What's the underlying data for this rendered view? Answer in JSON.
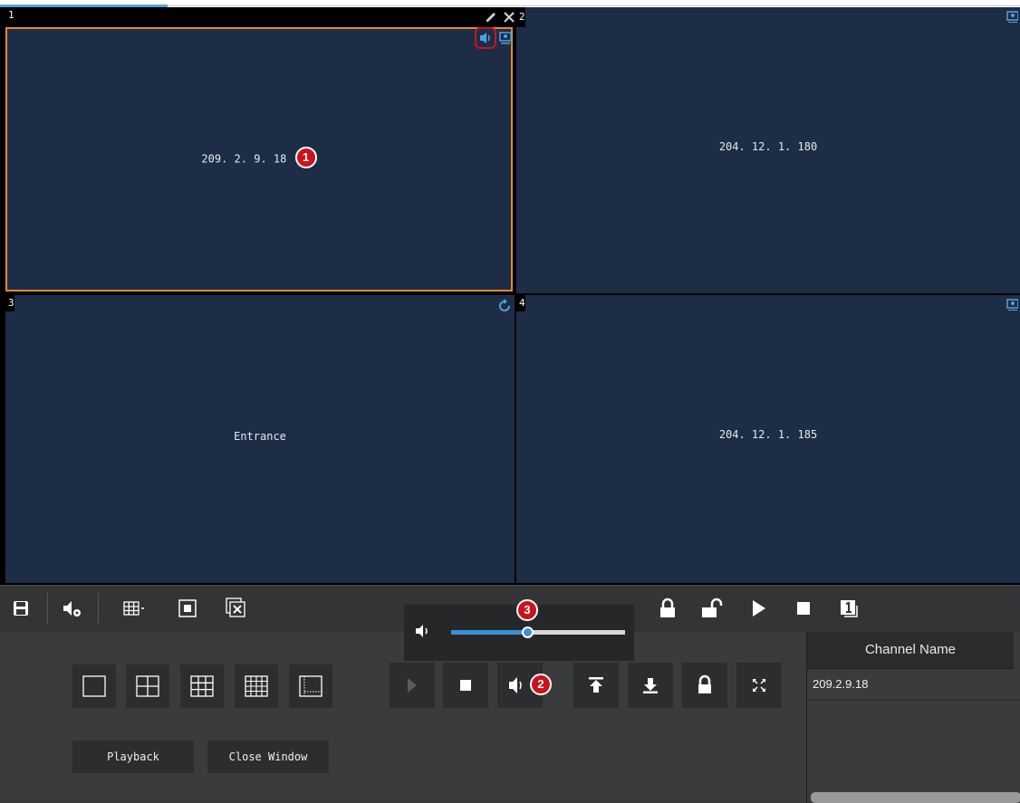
{
  "panes": [
    {
      "number": "1",
      "label": "209. 2. 9. 18"
    },
    {
      "number": "2",
      "label": "204. 12. 1. 180"
    },
    {
      "number": "3",
      "label": "Entrance"
    },
    {
      "number": "4",
      "label": "204. 12. 1. 185"
    }
  ],
  "callouts": {
    "one": "1",
    "two": "2",
    "three": "3"
  },
  "volume": {
    "level": 0.44
  },
  "buttons": {
    "playback": "Playback",
    "close_window": "Close Window"
  },
  "channel_table": {
    "header": "Channel Name",
    "rows": [
      "209.2.9.18"
    ]
  },
  "colors": {
    "video_bg": "#1e2d46",
    "selected_border": "#e08a2c",
    "accent_blue": "#4da3e0",
    "callout_red": "#c8141e"
  },
  "icons": [
    "edit-icon",
    "close-icon",
    "audio-icon",
    "monitor-icon",
    "refresh-icon",
    "save-icon",
    "audio-settings-icon",
    "layout-dropdown-icon",
    "window-fit-icon",
    "close-all-icon",
    "lock-icon",
    "unlock-icon",
    "play-icon",
    "stop-icon",
    "screen-one-icon"
  ]
}
